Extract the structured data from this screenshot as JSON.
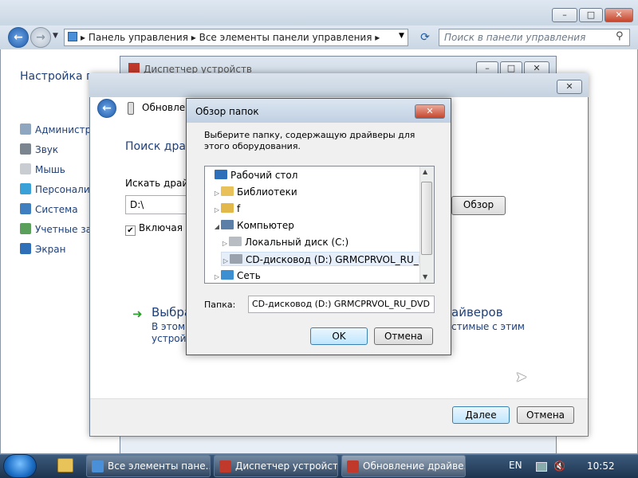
{
  "control_panel": {
    "breadcrumb": [
      "Панель управления",
      "Все элементы панели управления"
    ],
    "search_placeholder": "Поиск в панели управления",
    "heading": "Настройка п",
    "items": [
      {
        "label": "Администри",
        "icon": "admin-icon"
      },
      {
        "label": "Звук",
        "icon": "sound-icon"
      },
      {
        "label": "Мышь",
        "icon": "mouse-icon"
      },
      {
        "label": "Персонализ",
        "icon": "personalization-icon"
      },
      {
        "label": "Система",
        "icon": "system-icon"
      },
      {
        "label": "Учетные зап",
        "icon": "user-accounts-icon"
      },
      {
        "label": "Экран",
        "icon": "display-icon"
      }
    ]
  },
  "device_manager": {
    "title": "Диспетчер устройств"
  },
  "wizard": {
    "title": "Обновлен",
    "heading": "Поиск драй",
    "search_label": "Искать драйве",
    "path_value": "D:\\",
    "browse_label": "Обзор",
    "include_subfolders_label": "Включая в",
    "include_subfolders_checked": true,
    "choose_link_left": "Выбра",
    "choose_link_right": "айверов",
    "choose_desc_left": "В этом с устройс",
    "choose_desc_right": "стимые с этим",
    "next_label": "Далее",
    "cancel_label": "Отмена"
  },
  "browse_dialog": {
    "title": "Обзор папок",
    "instruction": "Выберите папку, содержащую драйверы для этого оборудования.",
    "tree": [
      {
        "label": "Рабочий стол",
        "level": 0,
        "expander": "",
        "icon": "desktop-icon"
      },
      {
        "label": "Библиотеки",
        "level": 1,
        "expander": "▷",
        "icon": "libraries-icon"
      },
      {
        "label": "f",
        "level": 1,
        "expander": "▷",
        "icon": "user-folder-icon"
      },
      {
        "label": "Компьютер",
        "level": 1,
        "expander": "◢",
        "icon": "computer-icon"
      },
      {
        "label": "Локальный диск (C:)",
        "level": 2,
        "expander": "▷",
        "icon": "local-disk-icon"
      },
      {
        "label": "CD-дисковод (D:) GRMCPRVOL_RU_DVD",
        "level": 2,
        "expander": "▷",
        "icon": "cd-drive-icon",
        "selected": true
      },
      {
        "label": "Сеть",
        "level": 1,
        "expander": "▷",
        "icon": "network-icon"
      }
    ],
    "folder_label": "Папка:",
    "folder_value": "CD-дисковод (D:) GRMCPRVOL_RU_DVD",
    "ok_label": "OK",
    "cancel_label": "Отмена"
  },
  "taskbar": {
    "buttons": [
      {
        "label": "Все элементы пане...",
        "icon": "control-panel-icon"
      },
      {
        "label": "Диспетчер устройств",
        "icon": "device-manager-icon"
      },
      {
        "label": "Обновление драйве...",
        "icon": "update-driver-icon"
      }
    ],
    "language": "EN",
    "time": "10:52"
  }
}
